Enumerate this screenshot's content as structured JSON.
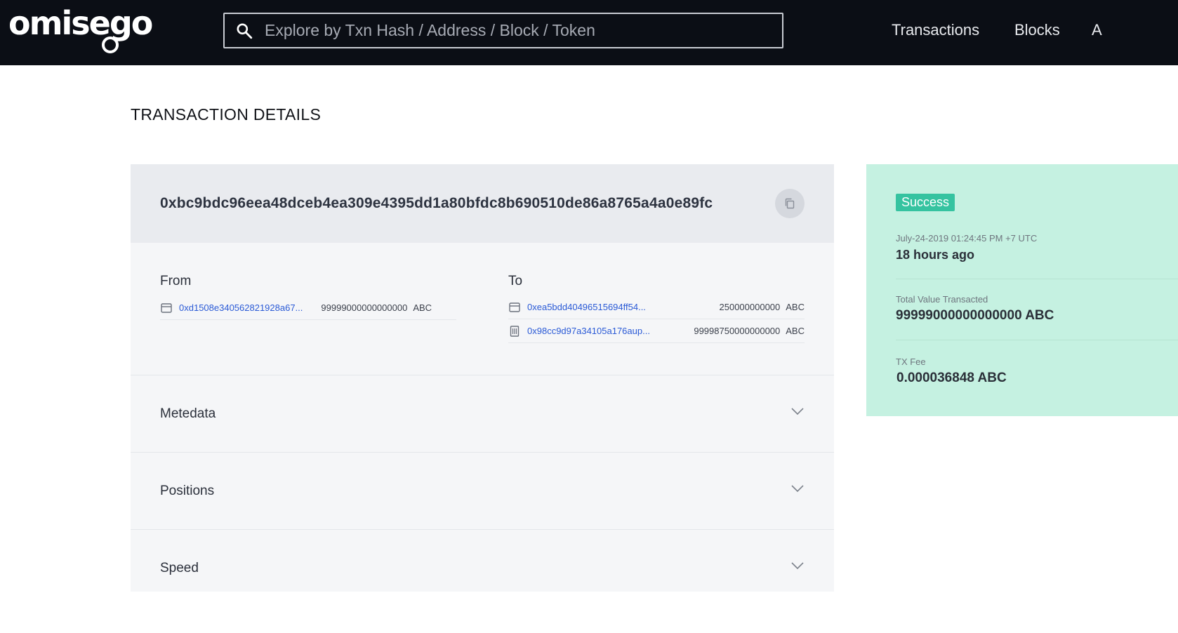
{
  "header": {
    "logo_text": "omisego",
    "search_placeholder": "Explore by Txn Hash / Address / Block / Token",
    "nav": {
      "transactions": "Transactions",
      "blocks": "Blocks",
      "more": "A"
    }
  },
  "page": {
    "title": "TRANSACTION DETAILS"
  },
  "transaction": {
    "hash": "0xbc9bdc96eea48dceb4ea309e4395dd1a80bfdc8b690510de86a8765a4a0e89fc",
    "from_label": "From",
    "to_label": "To",
    "inputs": [
      {
        "address": "0xd1508e340562821928a67...",
        "amount": "99999000000000000",
        "unit": "ABC",
        "icon": "wallet-icon"
      }
    ],
    "outputs": [
      {
        "address": "0xea5bdd40496515694ff54...",
        "amount": "250000000000",
        "unit": "ABC",
        "icon": "wallet-icon"
      },
      {
        "address": "0x98cc9d97a34105a176aup...",
        "amount": "99998750000000000",
        "unit": "ABC",
        "icon": "contract-icon"
      }
    ],
    "sections": [
      {
        "label": "Metedata"
      },
      {
        "label": "Positions"
      },
      {
        "label": "Speed"
      }
    ]
  },
  "status": {
    "badge": "Success",
    "timestamp": "July-24-2019 01:24:45 PM +7 UTC",
    "relative_time": "18 hours ago",
    "total_label": "Total Value Transacted",
    "total_value": "99999000000000000 ABC",
    "fee_label": "TX Fee",
    "fee_value": "0.000036848 ABC"
  },
  "colors": {
    "header_bg": "#0b0e15",
    "link": "#2a5ad6",
    "success_panel": "#c5f1e1",
    "success_badge": "#35c3a0"
  }
}
